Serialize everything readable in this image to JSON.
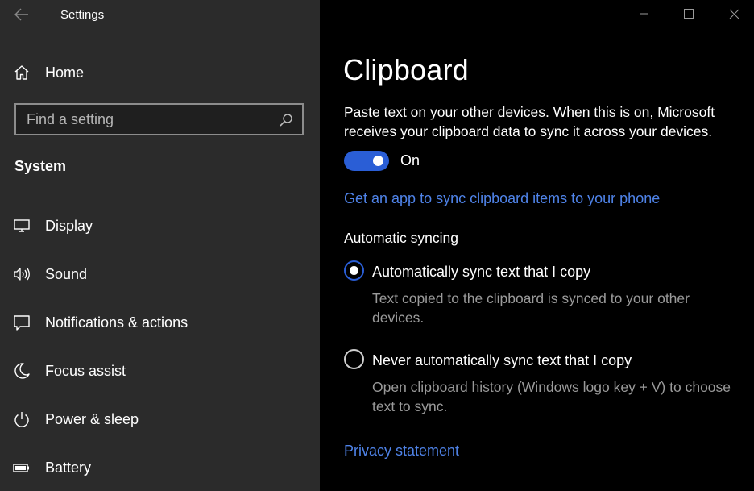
{
  "window": {
    "title": "Settings"
  },
  "sidebar": {
    "home_label": "Home",
    "search": {
      "placeholder": "Find a setting"
    },
    "section_heading": "System",
    "items": [
      {
        "label": "Display",
        "icon": "display-icon"
      },
      {
        "label": "Sound",
        "icon": "sound-icon"
      },
      {
        "label": "Notifications & actions",
        "icon": "notifications-icon"
      },
      {
        "label": "Focus assist",
        "icon": "moon-icon"
      },
      {
        "label": "Power & sleep",
        "icon": "power-icon"
      },
      {
        "label": "Battery",
        "icon": "battery-icon"
      }
    ]
  },
  "main": {
    "title": "Clipboard",
    "sync_description": "Paste text on your other devices. When this is on, Microsoft receives your clipboard data to sync it across your devices.",
    "sync_toggle": {
      "state": "On",
      "on": true
    },
    "phone_link": "Get an app to sync clipboard items to your phone",
    "auto_sync_heading": "Automatic syncing",
    "options": [
      {
        "label": "Automatically sync text that I copy",
        "description": "Text copied to the clipboard is synced to your other devices.",
        "selected": true
      },
      {
        "label": "Never automatically sync text that I copy",
        "description": "Open clipboard history (Windows logo key + V) to choose text to sync.",
        "selected": false
      }
    ],
    "privacy_link": "Privacy statement"
  },
  "colors": {
    "accent": "#2a5ed6",
    "link": "#4f83e8",
    "sidebar_bg": "#2b2b2b",
    "content_bg": "#000000",
    "secondary_text": "#9a9a9a"
  }
}
